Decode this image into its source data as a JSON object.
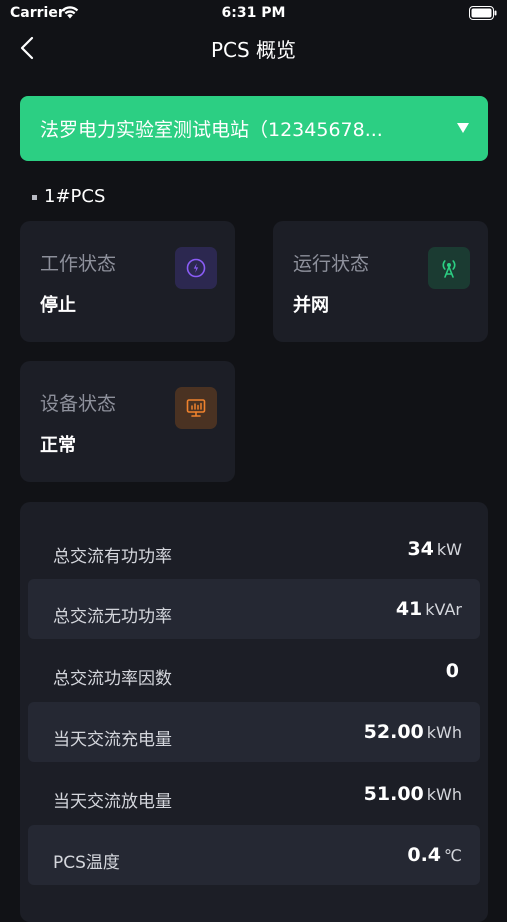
{
  "status_bar": {
    "carrier": "Carrier",
    "time": "6:31 PM"
  },
  "nav": {
    "title": "PCS 概览"
  },
  "station": {
    "name": "法罗电力实验室测试电站（12345678..."
  },
  "section": {
    "title": "1#PCS"
  },
  "cards": [
    {
      "label": "工作状态",
      "value": "停止",
      "icon": "power-icon",
      "icon_color": "#8a5cf6",
      "icon_bg": "#2c2850"
    },
    {
      "label": "运行状态",
      "value": "并网",
      "icon": "antenna-icon",
      "icon_color": "#2ccf83",
      "icon_bg": "#1b3b32"
    },
    {
      "label": "设备状态",
      "value": "正常",
      "icon": "monitor-chart-icon",
      "icon_color": "#f0822d",
      "icon_bg": "#4a3222"
    }
  ],
  "metrics": [
    {
      "label": "总交流有功功率",
      "value": "34",
      "unit": "kW"
    },
    {
      "label": "总交流无功功率",
      "value": "41",
      "unit": "kVAr"
    },
    {
      "label": "总交流功率因数",
      "value": "0",
      "unit": ""
    },
    {
      "label": "当天交流充电量",
      "value": "52.00",
      "unit": "kWh"
    },
    {
      "label": "当天交流放电量",
      "value": "51.00",
      "unit": "kWh"
    },
    {
      "label": "PCS温度",
      "value": "0.4",
      "unit": "℃"
    }
  ],
  "colors": {
    "accent": "#2ccf83",
    "background": "#111216",
    "card": "#1c1e26"
  }
}
